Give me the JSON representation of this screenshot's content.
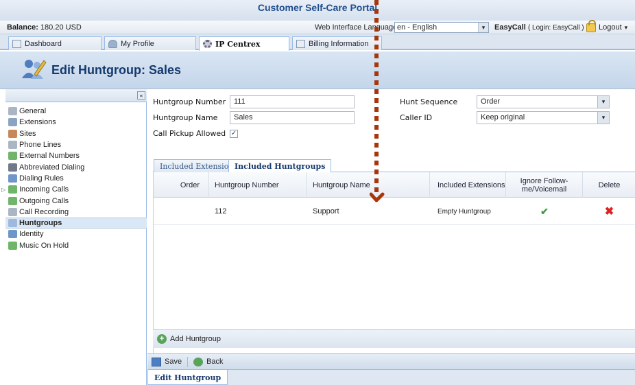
{
  "portal_title": "Customer Self-Care Portal",
  "balance": {
    "label": "Balance:",
    "value": "180.20 USD"
  },
  "language": {
    "label": "Web Interface Language:",
    "selected": "en - English"
  },
  "account": {
    "name": "EasyCall",
    "login": "( Login: EasyCall )"
  },
  "logout_label": "Logout",
  "main_tabs": [
    {
      "label": "Dashboard",
      "icon": "dashboard-icon"
    },
    {
      "label": "My Profile",
      "icon": "person-icon"
    },
    {
      "label": "IP Centrex",
      "icon": "gear-icon",
      "active": true
    },
    {
      "label": "Billing Information",
      "icon": "document-icon"
    }
  ],
  "page_title": "Edit Huntgroup: Sales",
  "sidebar": {
    "collapse_glyph": "«",
    "items": [
      {
        "label": "General",
        "icon": "gear-icon"
      },
      {
        "label": "Extensions",
        "icon": "extensions-icon"
      },
      {
        "label": "Sites",
        "icon": "sites-icon"
      },
      {
        "label": "Phone Lines",
        "icon": "phone-icon"
      },
      {
        "label": "External Numbers",
        "icon": "external-numbers-icon"
      },
      {
        "label": "Abbreviated Dialing",
        "icon": "abbreviated-dialing-icon"
      },
      {
        "label": "Dialing Rules",
        "icon": "dialing-rules-icon"
      },
      {
        "label": "Incoming Calls",
        "icon": "incoming-calls-icon",
        "expander": "▷"
      },
      {
        "label": "Outgoing Calls",
        "icon": "outgoing-calls-icon"
      },
      {
        "label": "Call Recording",
        "icon": "call-recording-icon"
      },
      {
        "label": "Huntgroups",
        "icon": "huntgroups-icon",
        "active": true
      },
      {
        "label": "Identity",
        "icon": "identity-icon"
      },
      {
        "label": "Music On Hold",
        "icon": "music-icon"
      }
    ]
  },
  "form": {
    "huntgroup_number": {
      "label": "Huntgroup Number",
      "value": "111"
    },
    "huntgroup_name": {
      "label": "Huntgroup Name",
      "value": "Sales"
    },
    "call_pickup": {
      "label": "Call Pickup Allowed",
      "checked_glyph": "✓"
    },
    "hunt_sequence": {
      "label": "Hunt Sequence",
      "value": "Order"
    },
    "caller_id": {
      "label": "Caller ID",
      "value": "Keep original"
    }
  },
  "sub_tabs": [
    {
      "label": "Included Extensions"
    },
    {
      "label": "Included Huntgroups",
      "active": true
    }
  ],
  "grid": {
    "columns": [
      "Order",
      "Huntgroup Number",
      "Huntgroup Name",
      "Included Extensions",
      "Ignore Follow-me/Voicemail",
      "Delete"
    ],
    "rows": [
      {
        "order": "",
        "number": "112",
        "name": "Support",
        "included": "Empty Huntgroup",
        "ignore_glyph": "✔",
        "delete_glyph": "✖"
      }
    ]
  },
  "add_huntgroup_label": "Add Huntgroup",
  "toolbar": {
    "save_label": "Save",
    "back_label": "Back"
  },
  "bottom_tab": "Edit Huntgroup",
  "colors": {
    "accent": "#15396d",
    "annotation": "#a8360b",
    "tab_border": "#99bbe8"
  }
}
